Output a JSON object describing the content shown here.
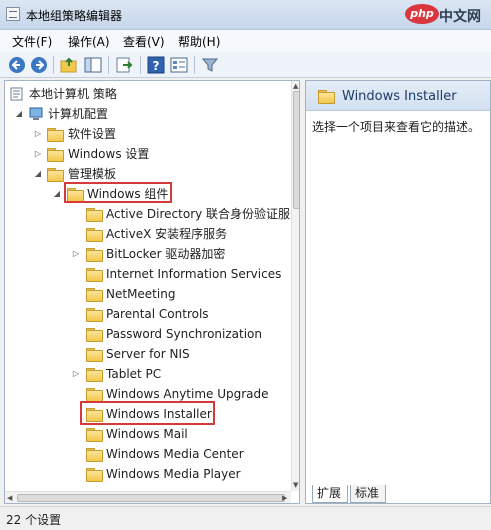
{
  "window": {
    "title": "本地组策略编辑器"
  },
  "watermark": {
    "logo": "php",
    "text": "中文网"
  },
  "menu": [
    "文件(F)",
    "操作(A)",
    "查看(V)",
    "帮助(H)"
  ],
  "toolbar": {
    "buttons": [
      "back-arrow-icon",
      "forward-arrow-icon",
      "folder-up-icon",
      "show-hide-tree-icon",
      "export-list-icon",
      "help-icon",
      "properties-icon",
      "filter-icon"
    ]
  },
  "tree": {
    "root": "本地计算机 策略",
    "computer_config": "计算机配置",
    "software_settings": "软件设置",
    "windows_settings": "Windows 设置",
    "admin_templates": "管理模板",
    "windows_components": "Windows 组件",
    "children": [
      "Active Directory 联合身份验证服务",
      "ActiveX 安装程序服务",
      "BitLocker 驱动器加密",
      "Internet Information Services",
      "NetMeeting",
      "Parental Controls",
      "Password Synchronization",
      "Server for NIS",
      "Tablet PC",
      "Windows Anytime Upgrade",
      "Windows Installer",
      "Windows Mail",
      "Windows Media Center",
      "Windows Media Player"
    ]
  },
  "details": {
    "title": "Windows Installer",
    "description": "选择一个项目来查看它的描述。",
    "tabs": [
      "扩展",
      "标准"
    ]
  },
  "status": {
    "text": "22 个设置"
  },
  "colors": {
    "highlight": "#d43a3a",
    "folder": "#f2c94c",
    "header": "#d2e0f0"
  }
}
